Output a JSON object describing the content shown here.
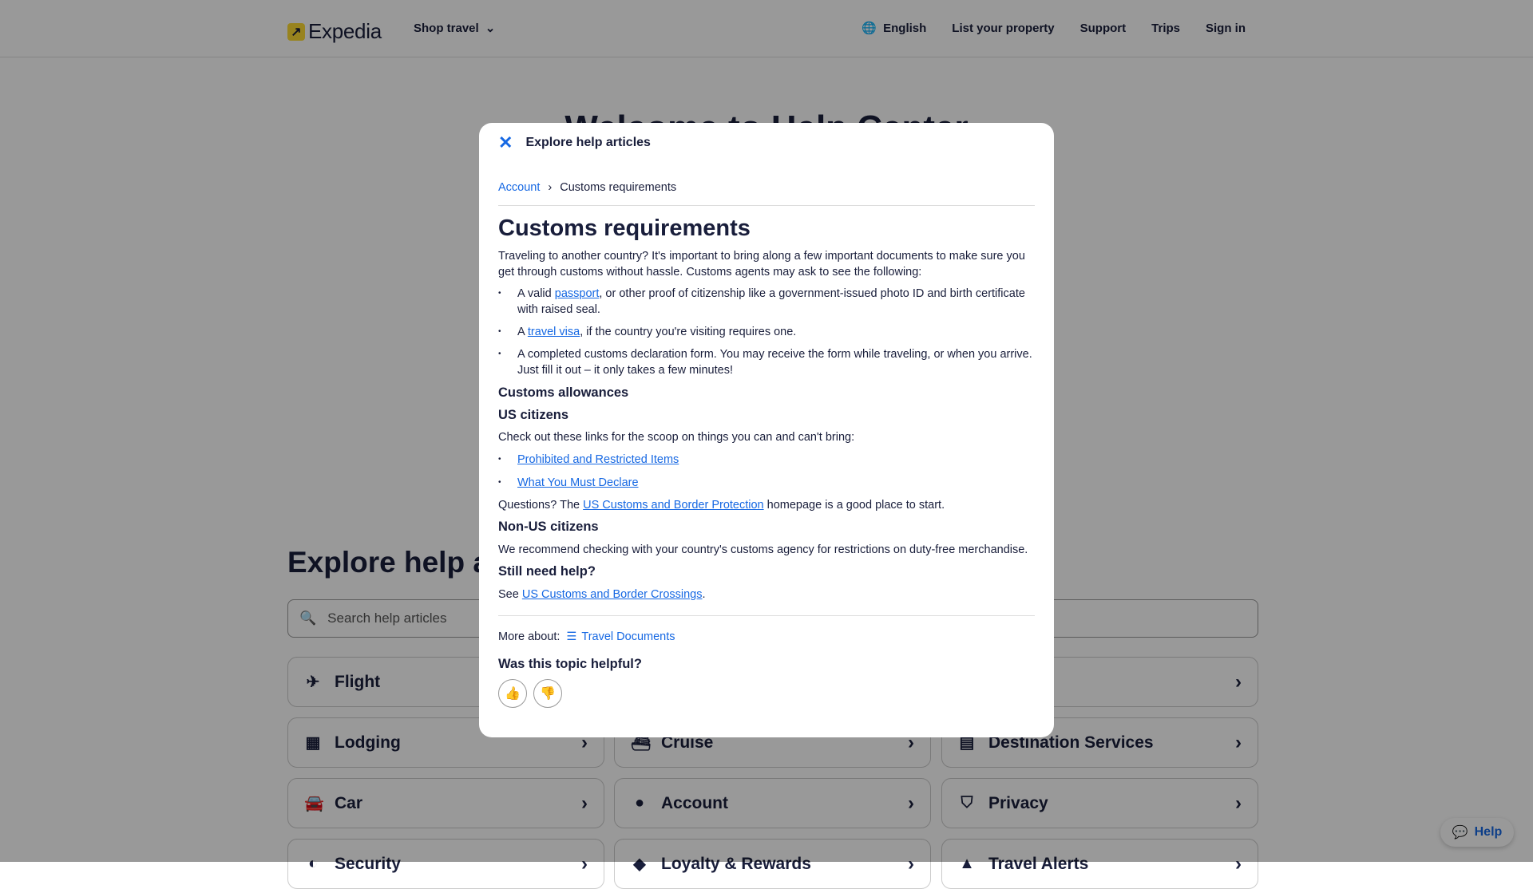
{
  "header": {
    "logo": "Expedia",
    "shop_travel": "Shop travel",
    "nav": [
      "English",
      "List your property",
      "Support",
      "Trips",
      "Sign in"
    ]
  },
  "page": {
    "welcome": "Welcome to Help Center",
    "explore": "Explore help articles",
    "search_placeholder": "Search help articles",
    "cards": [
      [
        "Flight",
        "flight-icon",
        "✈"
      ],
      [
        "",
        "",
        ""
      ],
      [
        "",
        "",
        ""
      ],
      [
        "Lodging",
        "building-icon",
        "▦"
      ],
      [
        "Cruise",
        "cruise-icon",
        "⛴"
      ],
      [
        "Destination Services",
        "ticket-icon",
        "▤"
      ],
      [
        "Car",
        "car-icon",
        "🚘"
      ],
      [
        "Account",
        "account-icon",
        "●"
      ],
      [
        "Privacy",
        "shield-icon",
        "⛉"
      ],
      [
        "Security",
        "security-icon",
        "◐"
      ],
      [
        "Loyalty & Rewards",
        "tag-icon",
        "◆"
      ],
      [
        "Travel Alerts",
        "alert-icon",
        "▲"
      ]
    ],
    "help_button": "Help"
  },
  "modal": {
    "title": "Explore help articles",
    "breadcrumb": [
      "Account",
      "Customs requirements"
    ],
    "heading": "Customs requirements",
    "intro": "Traveling to another country? It's important to bring along a few important documents to make sure you get through customs without hassle. Customs agents may ask to see the following:",
    "b1a": "A valid ",
    "b1link": "passport",
    "b1b": ", or other proof of citizenship like a government-issued photo ID and birth certificate with raised seal.",
    "b2a": "A ",
    "b2link": "travel visa",
    "b2b": ", if the country you're visiting requires one.",
    "b3": "A completed customs declaration form. You may receive the form while traveling, or when you arrive. Just fill it out – it only takes a few minutes!",
    "h_allow": "Customs allowances",
    "h_us": "US citizens",
    "check": "Check out these links for the scoop on things you can and can't bring:",
    "link1": "Prohibited and Restricted Items",
    "link2": "What You Must Declare",
    "q_a": "Questions? The ",
    "q_link": "US Customs and Border Protection",
    "q_b": " homepage is a good place to start.",
    "h_nonus": "Non-US citizens",
    "nonus": "We recommend checking with your country's customs agency for restrictions on duty-free merchandise.",
    "h_still": "Still need help?",
    "see_a": "See ",
    "see_link": "US Customs and Border Crossings",
    "see_b": ".",
    "more_label": "More about:",
    "more_link": "Travel Documents",
    "helpful": "Was this topic helpful?"
  },
  "colors": {
    "accent": "#1668e3",
    "logo": "#fddb32"
  }
}
